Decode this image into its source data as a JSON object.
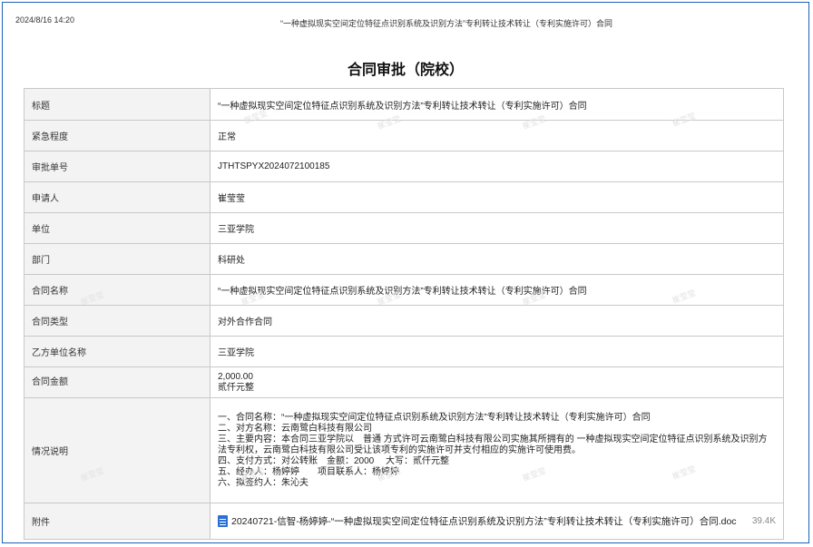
{
  "header": {
    "datetime": "2024/8/16 14:20",
    "doc_title": "“一种虚拟现实空间定位特征点识别系统及识别方法”专利转让技术转让（专利实施许可）合同"
  },
  "title": "合同审批（院校）",
  "fields": {
    "title": {
      "label": "标题",
      "value": "“一种虚拟现实空间定位特征点识别系统及识别方法”专利转让技术转让（专利实施许可）合同"
    },
    "urgency": {
      "label": "紧急程度",
      "value": "正常"
    },
    "approval_no": {
      "label": "审批单号",
      "value": "JTHTSPYX2024072100185"
    },
    "applicant": {
      "label": "申请人",
      "value": "崔莹莹"
    },
    "unit": {
      "label": "单位",
      "value": "三亚学院"
    },
    "department": {
      "label": "部门",
      "value": "科研处"
    },
    "contract_name": {
      "label": "合同名称",
      "value": "“一种虚拟现实空间定位特征点识别系统及识别方法”专利转让技术转让（专利实施许可）合同"
    },
    "contract_type": {
      "label": "合同类型",
      "value": "对外合作合同"
    },
    "party_b": {
      "label": "乙方单位名称",
      "value": "三亚学院"
    },
    "amount": {
      "label": "合同金额",
      "value": "2,000.00",
      "value_cn": "贰仟元整"
    },
    "description": {
      "label": "情况说明",
      "lines": [
        "一、合同名称：“一种虚拟现实空间定位特征点识别系统及识别方法”专利转让技术转让（专利实施许可）合同",
        "二、对方名称：云南鹭白科技有限公司",
        "三、主要内容：本合同三亚学院以　普通 方式许可云南鹭白科技有限公司实施其所拥有的 一种虚拟现实空间定位特征点识别系统及识别方法专利权，云南鹭白科技有限公司受让该项专利的实施许可并支付相应的实施许可使用费。",
        "四、支付方式：对公转账　金额：2000　 大写：贰仟元整",
        "五、经办人：杨婷婷　　项目联系人：杨婷婷",
        "六、拟签约人：朱沁夫"
      ]
    },
    "attachment": {
      "label": "附件",
      "file_name": "20240721-信智-杨婷婷-“一种虚拟现实空间定位特征点识别系统及识别方法”专利转让技术转让（专利实施许可）合同.doc",
      "size": "39.4K",
      "icon": "doc-file-icon"
    }
  },
  "watermark": "崔莹莹"
}
